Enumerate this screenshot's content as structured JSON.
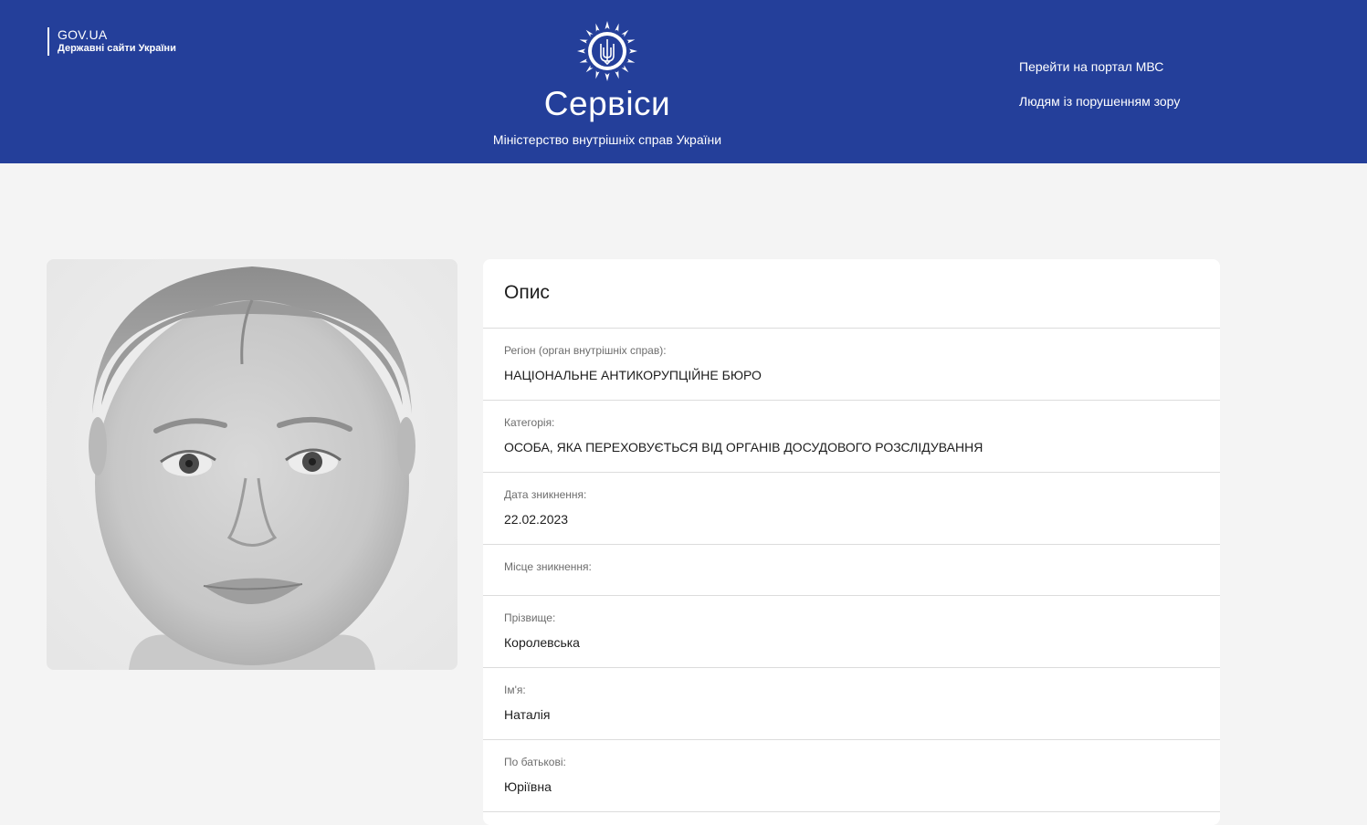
{
  "header": {
    "gov_title": "GOV.UA",
    "gov_subtitle": "Державні сайти України",
    "emblem_icon": "police-emblem-icon",
    "brand_title": "Сервіси",
    "brand_subtitle": "Міністерство внутрішніх справ України",
    "links": [
      "Перейти на портал МВС",
      "Людям із порушенням зору"
    ],
    "bg_color": "#243f9a"
  },
  "photo": {
    "icon": "person-photo"
  },
  "description": {
    "title": "Опис",
    "fields": [
      {
        "label": "Регіон (орган внутрішніх справ):",
        "value": "НАЦІОНАЛЬНЕ АНТИКОРУПЦІЙНЕ БЮРО"
      },
      {
        "label": "Категорія:",
        "value": "ОСОБА, ЯКА ПЕРЕХОВУЄТЬСЯ ВІД ОРГАНІВ ДОСУДОВОГО РОЗСЛІДУВАННЯ"
      },
      {
        "label": "Дата зникнення:",
        "value": "22.02.2023"
      },
      {
        "label": "Місце зникнення:",
        "value": ""
      },
      {
        "label": "Прізвище:",
        "value": "Королевська"
      },
      {
        "label": "Ім'я:",
        "value": "Наталія"
      },
      {
        "label": "По батькові:",
        "value": "Юріївна"
      }
    ]
  }
}
